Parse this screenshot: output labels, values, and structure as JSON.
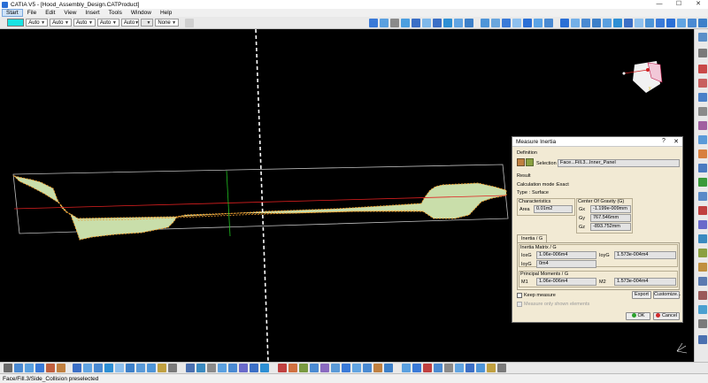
{
  "window": {
    "title": "CATIA V5 - [Hood_Assembly_Design.CATProduct]",
    "minimize": "—",
    "maximize": "☐",
    "close": "✕"
  },
  "menu": {
    "items": [
      "Start",
      "File",
      "Edit",
      "View",
      "Insert",
      "Tools",
      "Window",
      "Help"
    ]
  },
  "toolbar": {
    "color_swatch": "#19e3e3",
    "combos": [
      "Auto",
      "Auto",
      "Auto",
      "Auto",
      "Auto",
      "None"
    ]
  },
  "dialog": {
    "title": "Measure Inertia",
    "help": "?",
    "close": "✕",
    "definition_label": "Definition",
    "selection_label": "Selection :",
    "selection_value": "Face...Fill.3...Inner_Panel",
    "result_label": "Result",
    "calc_mode_label": "Calculation mode :",
    "calc_mode_value": "Exact",
    "type_label": "Type :",
    "type_value": "Surface",
    "characteristics_label": "Characteristics",
    "area_label": "Area",
    "area_value": "0.01m2",
    "cog_label": "Center Of Gravity (G)",
    "gx_label": "Gx",
    "gx_value": "-1.199e-009mm",
    "gy_label": "Gy",
    "gy_value": "767.546mm",
    "gz_label": "Gz",
    "gz_value": "-893.752mm",
    "tab_label": "Inertia / G",
    "inertia_matrix_label": "Inertia Matrix / G",
    "ioxg_label": "IoxG",
    "ioxg_value": "1.06e-006m4",
    "ioyg_label": "IoyG",
    "ioyg_value": "1.573e-004m4",
    "ioyg2_label": "IoyG",
    "ioyg2_value": "0m4",
    "principal_label": "Principal Moments / G",
    "m1_label": "M1",
    "m1_value": "1.06e-006m4",
    "m2_label": "M2",
    "m2_value": "1.573e-004m4",
    "keep_measure_label": "Keep measure",
    "export_label": "Export",
    "customize_label": "Customize...",
    "shown_only_label": "Measure only shown elements",
    "ok_label": "OK",
    "cancel_label": "Cancel"
  },
  "status": {
    "text": "Face/Fill.3/Side_Collision preselected"
  },
  "colors": {
    "surface_fill": "#c9deaa",
    "surface_edge": "#f0a030",
    "axis_red": "#e02020",
    "axis_green": "#20c020"
  }
}
